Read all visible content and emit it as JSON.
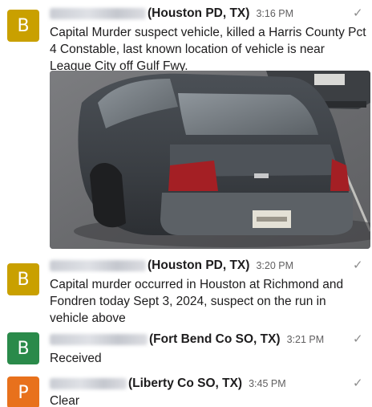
{
  "colors": {
    "avatar_yellow": "#c9a000",
    "avatar_green": "#2a8a4a",
    "avatar_orange": "#e8711c",
    "text": "#1d1c1d",
    "meta": "#616061"
  },
  "messages": [
    {
      "avatar": "B",
      "avatar_color": "#c9a000",
      "agency": "(Houston PD, TX)",
      "time": "3:16 PM",
      "text": "Capital Murder suspect vehicle, killed a Harris County Pct 4 Constable, last known location of vehicle is near League City off Gulf Fwy.",
      "icon": "check-icon"
    },
    {
      "avatar": "B",
      "avatar_color": "#c9a000",
      "agency": "(Houston PD, TX)",
      "time": "3:20 PM",
      "text": "Capital murder occurred in Houston at Richmond and Fondren today Sept 3, 2024, suspect on the run in vehicle above",
      "icon": "check-icon"
    },
    {
      "avatar": "B",
      "avatar_color": "#2a8a4a",
      "agency": "(Fort Bend Co SO, TX)",
      "time": "3:21 PM",
      "text": "Received",
      "icon": "check-icon"
    },
    {
      "avatar": "P",
      "avatar_color": "#e8711c",
      "agency": "(Liberty Co SO, TX)",
      "time": "3:45 PM",
      "text": "Clear",
      "icon": "check-icon"
    }
  ]
}
